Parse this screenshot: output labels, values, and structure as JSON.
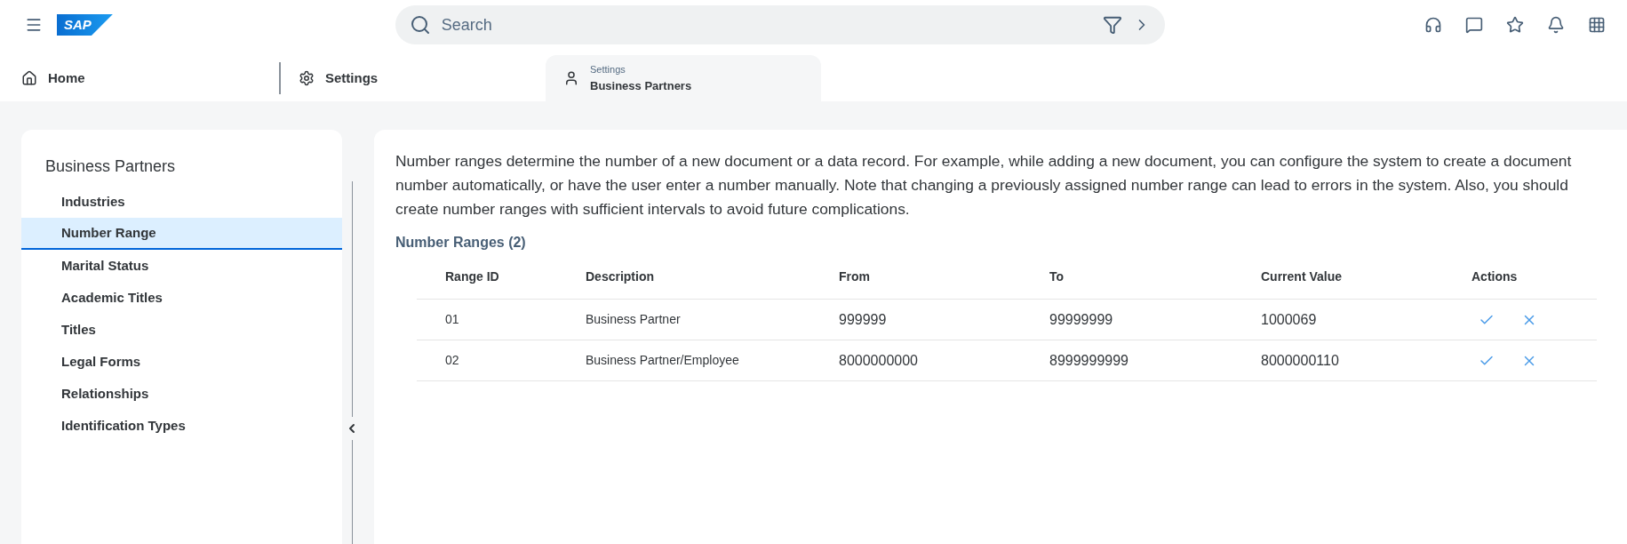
{
  "shell": {
    "logo": "SAP",
    "search": {
      "placeholder": "Search"
    }
  },
  "tabs": [
    {
      "kind": "home",
      "label": "Home",
      "selected": false
    },
    {
      "kind": "settings",
      "label": "Settings",
      "selected": false
    },
    {
      "kind": "person",
      "label": "Business Partners",
      "subtitle": "Settings",
      "selected": true
    }
  ],
  "sidebar": {
    "title": "Business Partners",
    "items": [
      {
        "label": "Industries",
        "selected": false
      },
      {
        "label": "Number Range",
        "selected": true
      },
      {
        "label": "Marital Status",
        "selected": false
      },
      {
        "label": "Academic Titles",
        "selected": false
      },
      {
        "label": "Titles",
        "selected": false
      },
      {
        "label": "Legal Forms",
        "selected": false
      },
      {
        "label": "Relationships",
        "selected": false
      },
      {
        "label": "Identification Types",
        "selected": false
      }
    ]
  },
  "description": "Number ranges determine the number of a new document or a data record. For example, while adding a new document, you can configure the system to create a document number automatically, or have the user enter a number manually. Note that changing a previously assigned number range can lead to errors in the system. Also, you should create number ranges with sufficient intervals to avoid future complications.",
  "table": {
    "title": "Number Ranges (2)",
    "columns": [
      "Range ID",
      "Description",
      "From",
      "To",
      "Current Value",
      "Actions"
    ],
    "rows": [
      {
        "range_id": "01",
        "description": "Business Partner",
        "from": "999999",
        "to": "99999999",
        "current_value": "1000069"
      },
      {
        "range_id": "02",
        "description": "Business Partner/Employee",
        "from": "8000000000",
        "to": "8999999999",
        "current_value": "8000000110"
      }
    ]
  }
}
